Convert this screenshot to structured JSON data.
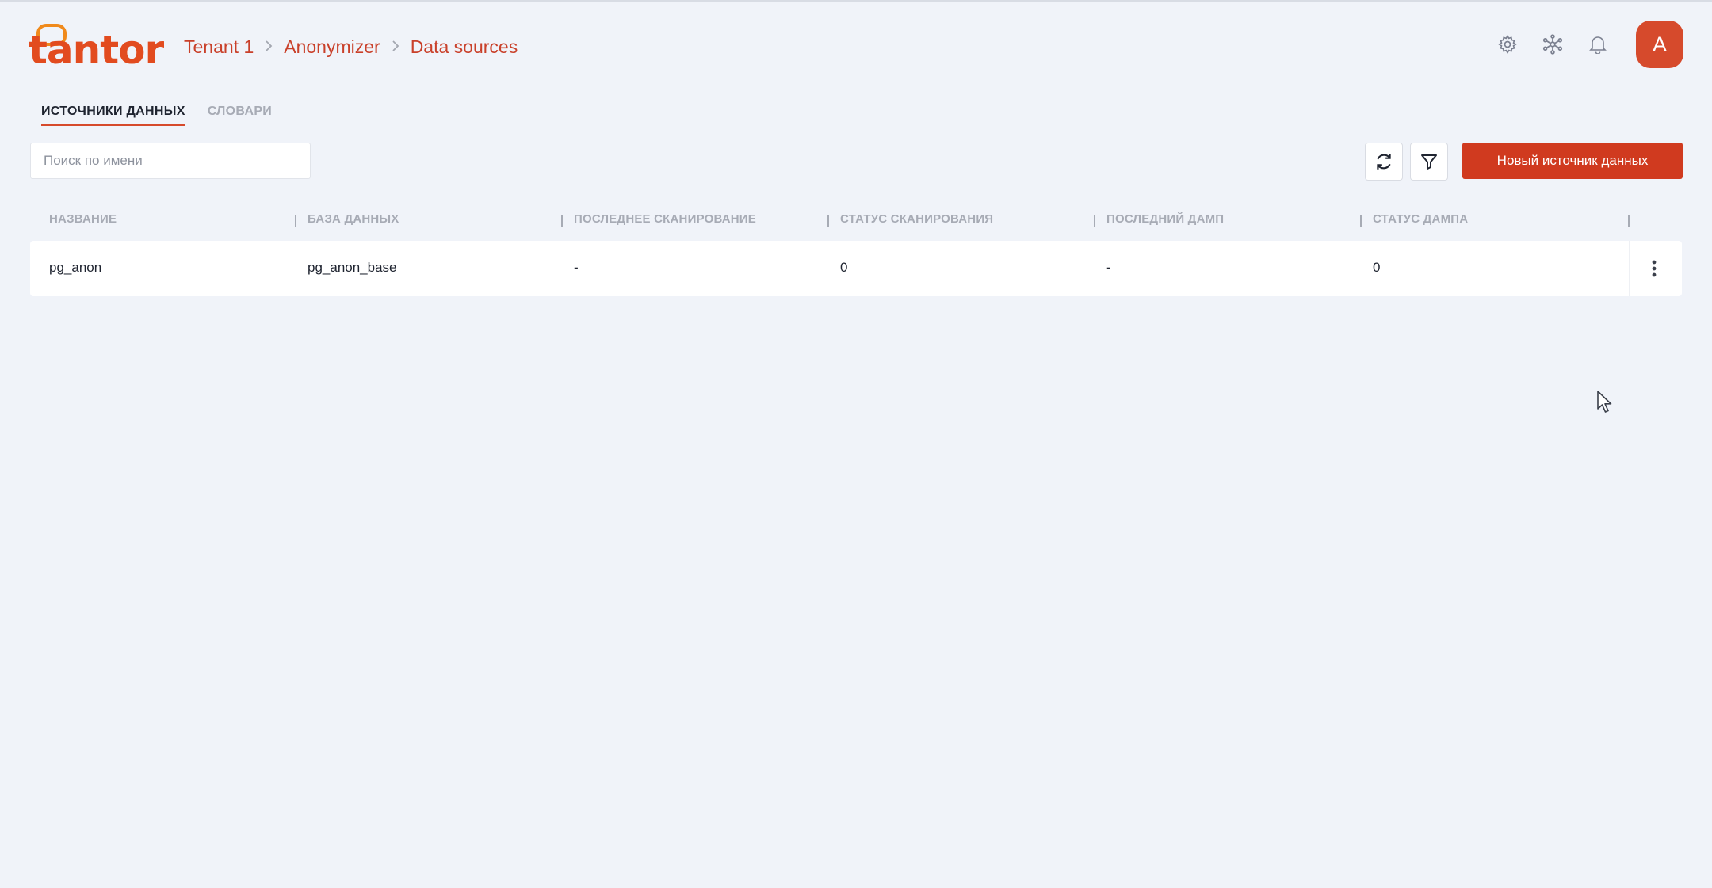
{
  "header": {
    "logo_text": "tantor",
    "breadcrumb": [
      "Tenant 1",
      "Anonymizer",
      "Data sources"
    ],
    "avatar_letter": "A",
    "icons": [
      "gear-icon",
      "network-icon",
      "bell-icon"
    ]
  },
  "tabs": [
    {
      "label": "ИСТОЧНИКИ ДАННЫХ",
      "active": true
    },
    {
      "label": "СЛОВАРИ",
      "active": false
    }
  ],
  "toolbar": {
    "search_placeholder": "Поиск по имени",
    "search_value": "",
    "new_button_label": "Новый источник данных",
    "refresh_icon": "refresh-icon",
    "filter_icon": "filter-icon"
  },
  "table": {
    "columns": [
      "НАЗВАНИЕ",
      "БАЗА ДАННЫХ",
      "ПОСЛЕДНЕЕ СКАНИРОВАНИЕ",
      "СТАТУС СКАНИРОВАНИЯ",
      "ПОСЛЕДНИЙ ДАМП",
      "СТАТУС ДАМПА"
    ],
    "rows": [
      [
        "pg_anon",
        "pg_anon_base",
        "-",
        "0",
        "-",
        "0"
      ]
    ]
  },
  "colors": {
    "accent": "#d03a1f",
    "logo_orange": "#f08a1c",
    "breadcrumb": "#c9402a",
    "background": "#f0f3f9"
  }
}
